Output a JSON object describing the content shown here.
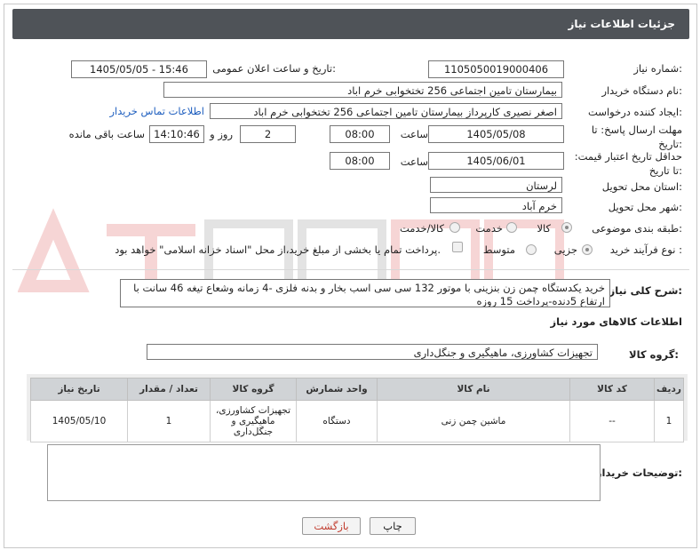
{
  "header": {
    "title": "جزئیات اطلاعات نیاز"
  },
  "fields": {
    "need_number_label": "شماره نیاز:",
    "need_number": "1105050019000406",
    "announce_label": "تاریخ و ساعت اعلان عمومی:",
    "announce_value": "1405/05/05 - 15:46",
    "buyer_label": "نام دستگاه خریدار:",
    "buyer_value": "بیمارستان تامین اجتماعی  256 تختخوابی خرم اباد",
    "creator_label": "ایجاد کننده درخواست:",
    "creator_value": "اصغر نصیری کارپرداز بیمارستان تامین اجتماعی  256 تختخوابی خرم اباد",
    "contact_link": "اطلاعات تماس خریدار",
    "deadline_label": "مهلت ارسال پاسخ: تا تاریخ:",
    "deadline_date": "1405/05/08",
    "time_label": "ساعت",
    "deadline_time": "08:00",
    "days_value": "2",
    "days_label": "روز و",
    "remain_time": "14:10:46",
    "remain_label": "ساعت باقی مانده",
    "validity_label": "حداقل تاریخ اعتبار قیمت: تا تاریخ:",
    "validity_date": "1405/06/01",
    "validity_time": "08:00",
    "province_label": "استان محل تحویل:",
    "province_value": "لرستان",
    "city_label": "شهر محل تحویل:",
    "city_value": "خرم آباد",
    "category_label": "طبقه بندی موضوعی:",
    "category_options": [
      "کالا",
      "خدمت",
      "کالا/خدمت"
    ],
    "process_label": "نوع فرآیند خرید :",
    "process_options": [
      "جزیی",
      "متوسط"
    ],
    "payment_text": "پرداخت تمام یا بخشی از مبلغ خرید،از محل \"اسناد خزانه اسلامی\" خواهد بود."
  },
  "description": {
    "label": "شرح کلی نیاز:",
    "text": "خرید یکدستگاه چمن زن بنزینی با موتور 132 سی سی اسب بخار و بدنه فلزی -4 زمانه وشعاع تیغه 46 سانت با ارتفاع 5دنده-پرداخت 15 روزه"
  },
  "goods": {
    "section_title": "اطلاعات کالاهای مورد نیاز",
    "group_label": "گروه کالا:",
    "group_value": "تجهیزات کشاورزی، ماهیگیری و جنگل‌داری"
  },
  "table": {
    "headers": [
      "ردیف",
      "کد کالا",
      "نام کالا",
      "واحد شمارش",
      "گروه کالا",
      "تعداد / مقدار",
      "تاریخ نیاز"
    ],
    "rows": [
      [
        "1",
        "--",
        "ماشین چمن زنی",
        "دستگاه",
        "تجهیزات کشاورزی، ماهیگیری و جنگل‌داری",
        "1",
        "1405/05/10"
      ]
    ]
  },
  "notes_label": "توضیحات خریدار:",
  "buttons": {
    "print": "چاپ",
    "back": "بازگشت"
  },
  "colors": {
    "header_bg": "#4f5358",
    "link": "#1f5fbf",
    "back_button_text": "#c0392b"
  }
}
